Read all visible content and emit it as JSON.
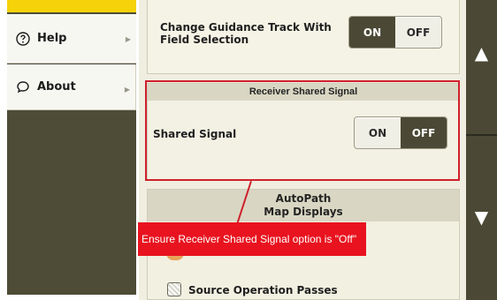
{
  "sidebar": {
    "items": [
      {
        "label": "Help",
        "icon": "question-circle-icon"
      },
      {
        "label": "About",
        "icon": "speech-bubble-icon"
      }
    ],
    "accent_color": "#f5d20a"
  },
  "settings": {
    "guidance_track": {
      "label_line1": "Change Guidance Track With",
      "label_line2": "Field Selection",
      "on_label": "ON",
      "off_label": "OFF",
      "selected": "ON"
    },
    "receiver_shared_signal": {
      "section_title": "Receiver Shared Signal",
      "label": "Shared Signal",
      "on_label": "ON",
      "off_label": "OFF",
      "selected": "OFF"
    },
    "autopath": {
      "title_line1": "AutoPath",
      "title_line2": "Map Displays",
      "source_operation_passes_label": "Source Operation Passes"
    }
  },
  "annotation": {
    "callout_text": "Ensure Receiver Shared Signal option is \"Off\"",
    "highlight_color": "#d0202d"
  },
  "scroll": {
    "up_icon": "triangle-up-icon",
    "down_icon": "triangle-down-icon"
  },
  "colors": {
    "toggle_active": "#4b4935",
    "rail": "#4b4935",
    "callout_bg": "#e8131f"
  }
}
